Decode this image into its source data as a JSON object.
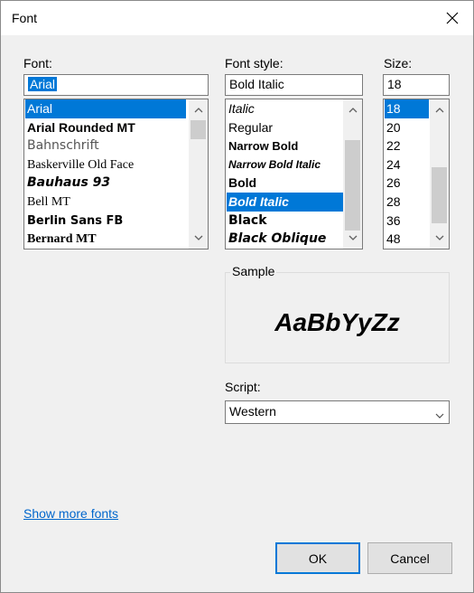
{
  "window": {
    "title": "Font"
  },
  "font": {
    "label": "Font:",
    "value": "Arial",
    "items": [
      "Arial",
      "Arial Rounded MT",
      "Bahnschrift",
      "Baskerville Old Face",
      "Bauhaus 93",
      "Bell MT",
      "Berlin Sans FB",
      "Bernard MT"
    ],
    "selected": "Arial"
  },
  "style": {
    "label": "Font style:",
    "value": "Bold Italic",
    "items": [
      "Italic",
      "Regular",
      "Narrow Bold",
      "Narrow Bold Italic",
      "Bold",
      "Bold Italic",
      "Black",
      "Black Oblique"
    ],
    "selected": "Bold Italic"
  },
  "size": {
    "label": "Size:",
    "value": "18",
    "items": [
      "18",
      "20",
      "22",
      "24",
      "26",
      "28",
      "36",
      "48"
    ],
    "selected": "18"
  },
  "sample": {
    "label": "Sample",
    "text": "AaBbYyZz"
  },
  "script": {
    "label": "Script:",
    "value": "Western"
  },
  "footer": {
    "more_fonts": "Show more fonts",
    "ok": "OK",
    "cancel": "Cancel"
  },
  "colors": {
    "accent": "#0078d7",
    "link": "#0066cc"
  }
}
